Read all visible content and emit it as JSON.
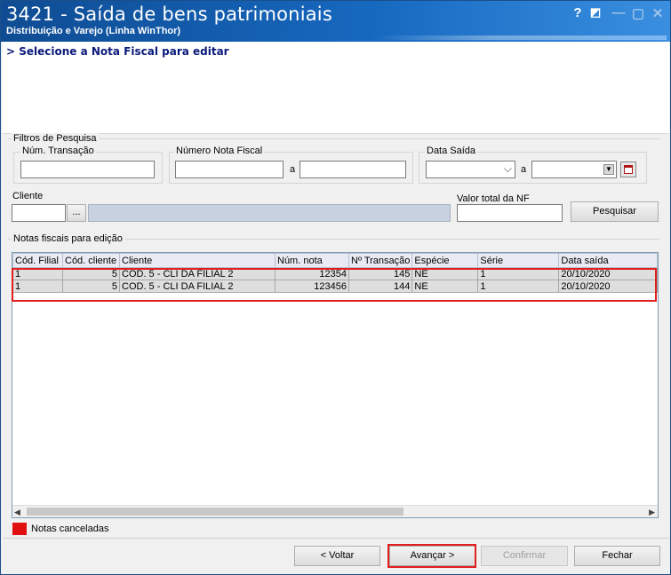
{
  "window": {
    "title": "3421 - Saída de bens patrimoniais",
    "subtitle": "Distribuição e Varejo (Linha WinThor)",
    "controls": [
      "?",
      "◩",
      "—",
      "▢",
      "✕"
    ]
  },
  "header": {
    "step": "> Selecione a Nota Fiscal para editar"
  },
  "filters": {
    "group_label": "Filtros de Pesquisa",
    "num_transacao": {
      "label": "Núm. Transação",
      "value": ""
    },
    "numero_nf": {
      "label": "Número Nota Fiscal",
      "from": "",
      "sep": "a",
      "to": ""
    },
    "data_saida": {
      "label": "Data Saída",
      "from": "",
      "sep": "a",
      "to": ""
    },
    "cliente": {
      "label": "Cliente",
      "code": "",
      "lookup": "...",
      "name": ""
    },
    "valor_total": {
      "label": "Valor total da NF",
      "value": ""
    },
    "search_label": "Pesquisar"
  },
  "grid": {
    "group_label": "Notas fiscais para edição",
    "columns": [
      "Cód. Filial",
      "Cód. cliente",
      "Cliente",
      "Núm. nota",
      "Nº Transação",
      "Espécie",
      "Série",
      "Data saída"
    ],
    "rows": [
      [
        "1",
        "5",
        "COD. 5 - CLI DA FILIAL 2",
        "12354",
        "145",
        "NE",
        "1",
        "20/10/2020"
      ],
      [
        "1",
        "5",
        "COD. 5 - CLI DA FILIAL 2",
        "123456",
        "144",
        "NE",
        "1",
        "20/10/2020"
      ]
    ]
  },
  "legend": {
    "label": "Notas canceladas",
    "color": "#e01010"
  },
  "footer": {
    "back": "< Voltar",
    "next": "Avançar >",
    "confirm": "Confirmar",
    "close": "Fechar"
  },
  "colors": {
    "title_bar": "#1668bf",
    "highlight": "#e21d1d",
    "header_text": "#0a1a7a"
  }
}
